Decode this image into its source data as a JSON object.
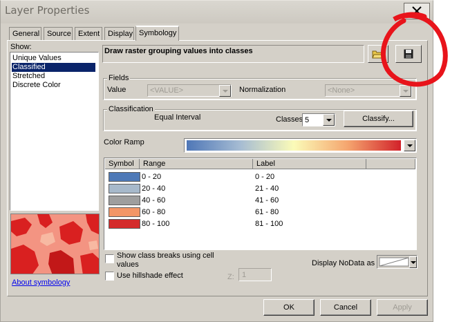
{
  "window": {
    "title": "Layer Properties",
    "close_label": "✕"
  },
  "tabs": [
    {
      "label": "General"
    },
    {
      "label": "Source"
    },
    {
      "label": "Extent"
    },
    {
      "label": "Display"
    },
    {
      "label": "Symbology",
      "active": true
    }
  ],
  "show": {
    "label": "Show:",
    "items": [
      "Unique Values",
      "Classified",
      "Stretched",
      "Discrete Color"
    ],
    "selected": "Classified"
  },
  "header": {
    "description": "Draw raster grouping values into classes"
  },
  "fields": {
    "group_label": "Fields",
    "value_label": "Value",
    "value_selected": "<VALUE>",
    "normalization_label": "Normalization",
    "normalization_selected": "<None>"
  },
  "classification": {
    "group_label": "Classification",
    "method": "Equal Interval",
    "classes_label": "Classes",
    "classes_value": "5",
    "classify_button": "Classify..."
  },
  "color_ramp": {
    "label": "Color Ramp",
    "colors": [
      "#4f77b7",
      "#a6bcd3",
      "#fbfbb8",
      "#f5a66f",
      "#d2222a"
    ]
  },
  "symbol_table": {
    "headers": {
      "symbol": "Symbol",
      "range": "Range",
      "label": "Label"
    },
    "rows": [
      {
        "color": "#4e79b7",
        "range": "0 - 20",
        "label": "0 - 20"
      },
      {
        "color": "#a7b9cb",
        "range": "20 - 40",
        "label": "21 - 40"
      },
      {
        "color": "#9e9e9e",
        "range": "40 - 60",
        "label": "41 - 60"
      },
      {
        "color": "#f39667",
        "range": "60 - 80",
        "label": "61 - 80"
      },
      {
        "color": "#d42b2b",
        "range": "80 - 100",
        "label": "81 - 100"
      }
    ]
  },
  "options": {
    "show_breaks_label": "Show class breaks using cell values",
    "show_breaks_checked": false,
    "hillshade_label": "Use hillshade effect",
    "hillshade_checked": false,
    "z_label": "Z:",
    "z_value": "1",
    "nodata_label": "Display NoData as"
  },
  "about_link": "About symbology",
  "buttons": {
    "ok": "OK",
    "cancel": "Cancel",
    "apply": "Apply"
  },
  "annotation": {
    "color": "#e8141b"
  }
}
